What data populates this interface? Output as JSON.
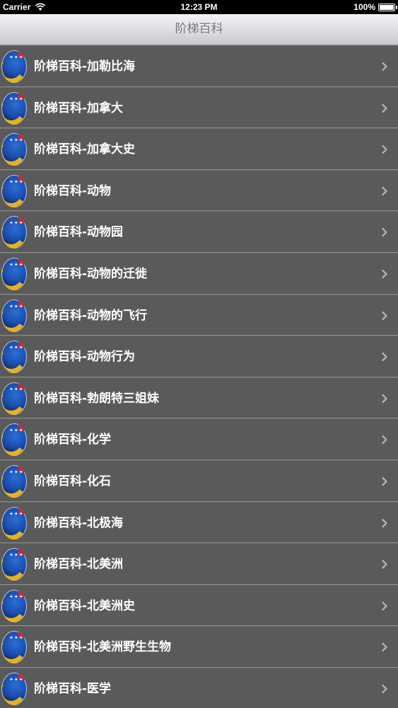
{
  "status_bar": {
    "carrier": "Carrier",
    "time": "12:23 PM",
    "battery": "100%",
    "battery_level": 1.0
  },
  "nav": {
    "title": "阶梯百科"
  },
  "list": {
    "items": [
      {
        "label": "阶梯百科-加勒比海"
      },
      {
        "label": "阶梯百科-加拿大"
      },
      {
        "label": "阶梯百科-加拿大史"
      },
      {
        "label": "阶梯百科-动物"
      },
      {
        "label": "阶梯百科-动物园"
      },
      {
        "label": "阶梯百科-动物的迁徙"
      },
      {
        "label": "阶梯百科-动物的飞行"
      },
      {
        "label": "阶梯百科-动物行为"
      },
      {
        "label": "阶梯百科-勃朗特三姐妹"
      },
      {
        "label": "阶梯百科-化学"
      },
      {
        "label": "阶梯百科-化石"
      },
      {
        "label": "阶梯百科-北极海"
      },
      {
        "label": "阶梯百科-北美洲"
      },
      {
        "label": "阶梯百科-北美洲史"
      },
      {
        "label": "阶梯百科-北美洲野生生物"
      },
      {
        "label": "阶梯百科-医学"
      }
    ]
  },
  "icons": {
    "row_icon": "app-logo-icon",
    "chevron": "chevron-right-icon",
    "wifi": "wifi-icon",
    "battery": "battery-icon"
  },
  "colors": {
    "status_bar_bg": "#000000",
    "row_bg": "#5a5a5a",
    "row_text": "#ffffff",
    "nav_title": "#6f7178"
  }
}
